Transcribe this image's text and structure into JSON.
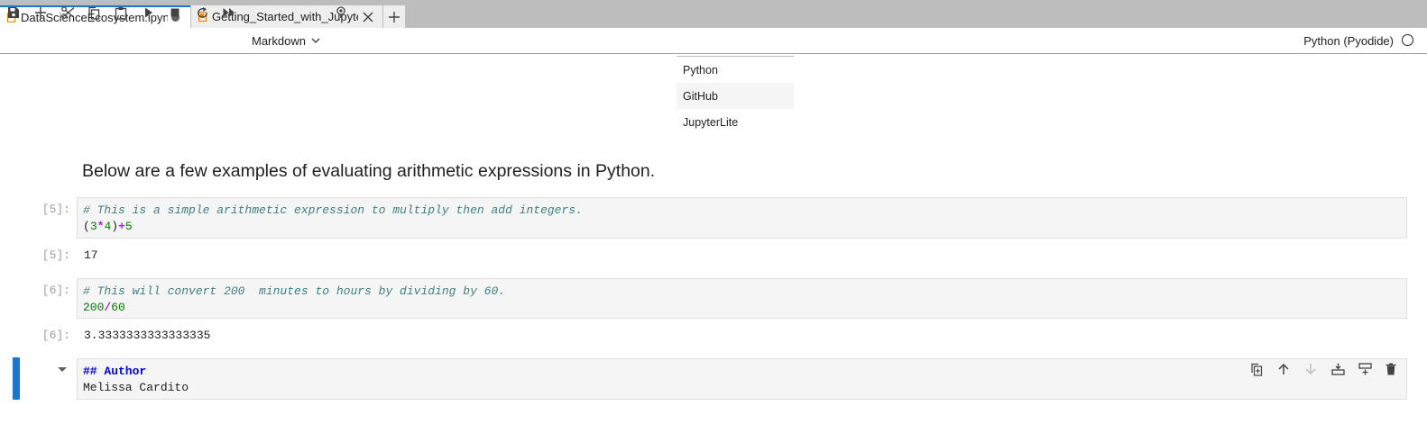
{
  "tabs": [
    {
      "label": "DataScienceEcosystem.ipynb",
      "active": true,
      "dirty": true
    },
    {
      "label": "Getting_Started_with_Jupyter.ipynb",
      "active": false,
      "dirty": false
    }
  ],
  "toolbar": {
    "cell_type": "Markdown",
    "kernel_name": "Python (Pyodide)",
    "icons": [
      "save-icon",
      "add-cell-icon",
      "cut-icon",
      "copy-icon",
      "paste-icon",
      "run-icon",
      "stop-icon",
      "restart-icon",
      "run-all-icon",
      "chevron-down-icon",
      "debugger-icon",
      "kernel-status-icon"
    ]
  },
  "mini_table": {
    "rows": [
      "Python",
      "GitHub",
      "JupyterLite"
    ]
  },
  "markdown_cell": {
    "text": "Below are a few examples of evaluating arithmetic expressions in Python."
  },
  "cells": [
    {
      "in_prompt": "[5]:",
      "comment": "# This is a simple arithmetic expression to multiply then add integers.",
      "code_tokens": [
        "(",
        "3",
        "*",
        "4",
        ")",
        "+",
        "5"
      ],
      "out_prompt": "[5]:",
      "output": "17"
    },
    {
      "in_prompt": "[6]:",
      "comment": "# This will convert 200  minutes to hours by dividing by 60.",
      "code_tokens": [
        "200",
        "/",
        "60"
      ],
      "out_prompt": "[6]:",
      "output": "3.3333333333333335"
    }
  ],
  "active_cell": {
    "header": "## Author",
    "text": "Melissa Cardito",
    "toolbar_icons": [
      "duplicate-cell-icon",
      "move-up-icon",
      "move-down-icon",
      "insert-above-icon",
      "insert-below-icon",
      "delete-cell-icon"
    ]
  },
  "colors": {
    "accent": "#1976d2",
    "comment": "#408080",
    "number": "#008000",
    "operator": "#aa22ff",
    "header": "#0000ff",
    "notebook_icon": "#f57c00"
  }
}
